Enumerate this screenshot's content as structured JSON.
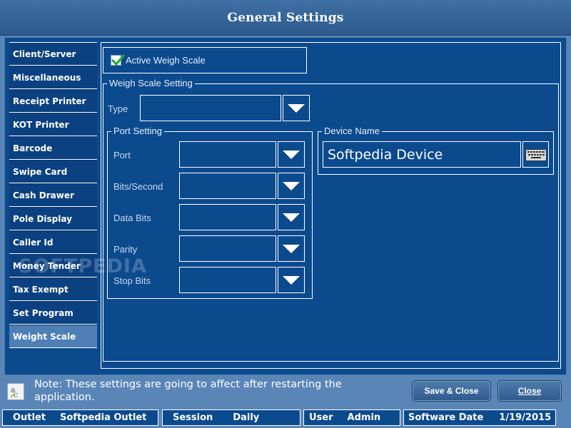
{
  "window": {
    "title": "General Settings"
  },
  "sidebar": {
    "items": [
      {
        "label": "Client/Server"
      },
      {
        "label": "Miscellaneous"
      },
      {
        "label": "Receipt Printer"
      },
      {
        "label": "KOT Printer"
      },
      {
        "label": "Barcode"
      },
      {
        "label": "Swipe Card"
      },
      {
        "label": "Cash Drawer"
      },
      {
        "label": "Pole Display"
      },
      {
        "label": "Caller Id"
      },
      {
        "label": "Money Tender"
      },
      {
        "label": "Tax Exempt"
      },
      {
        "label": "Set Program"
      },
      {
        "label": "Weight Scale"
      }
    ],
    "active_index": 12
  },
  "watermark": "SOFTPEDIA",
  "active_weigh_scale": {
    "label": "Active Weigh Scale",
    "checked": true
  },
  "weigh_scale_setting": {
    "legend": "Weigh Scale Setting",
    "type_label": "Type",
    "type_value": ""
  },
  "port_setting": {
    "legend": "Port Setting",
    "fields": [
      {
        "label": "Port",
        "value": ""
      },
      {
        "label": "Bits/Second",
        "value": ""
      },
      {
        "label": "Data Bits",
        "value": ""
      },
      {
        "label": "Parity",
        "value": ""
      },
      {
        "label": "Stop Bits",
        "value": ""
      }
    ]
  },
  "device_name": {
    "legend": "Device Name",
    "value": "Softpedia Device"
  },
  "footer": {
    "note": "Note: These settings are going to affect after restarting the application.",
    "save_close_label": "Save & Close",
    "close_label": "Close"
  },
  "status_bar": {
    "outlet_label": "Outlet",
    "outlet_value": "Softpedia Outlet",
    "session_label": "Session",
    "session_value": "Daily",
    "user_label": "User",
    "user_value": "Admin",
    "software_date_label": "Software Date",
    "software_date_value": "1/19/2015"
  },
  "colors": {
    "title_bar": "#2d5b8f",
    "panel_bg": "#0c4a8e",
    "active_nav": "#4e7fb5",
    "check_green": "#2aa33a"
  }
}
